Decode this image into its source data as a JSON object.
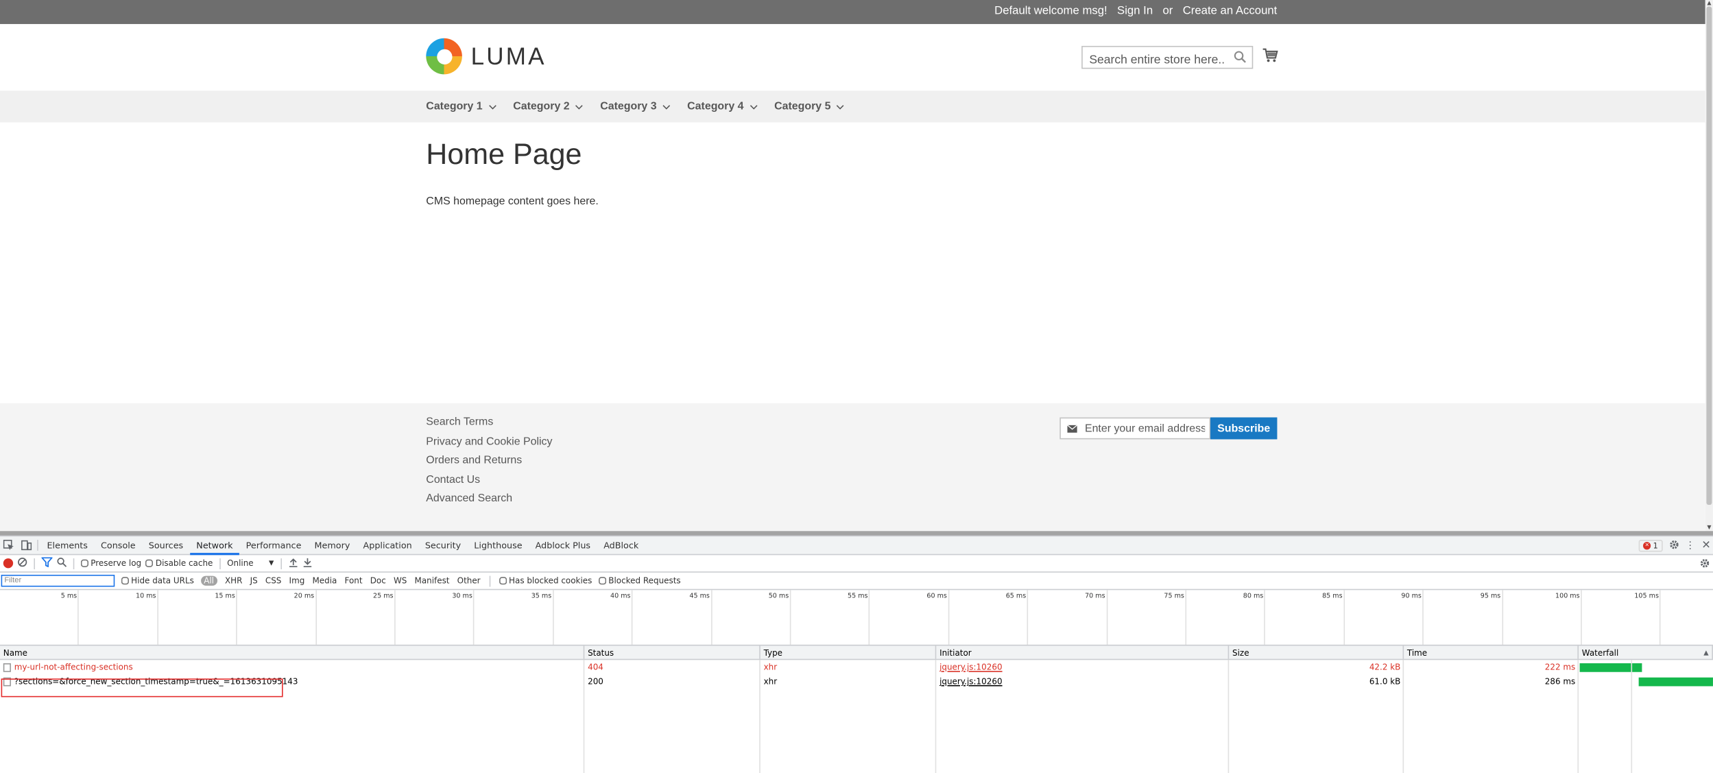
{
  "topbar": {
    "welcome": "Default welcome msg!",
    "sign_in": "Sign In",
    "or": "or",
    "create_account": "Create an Account"
  },
  "header": {
    "logo_text": "LUMA",
    "search_placeholder": "Search entire store here...",
    "cart_icon": "cart-icon"
  },
  "nav": {
    "items": [
      {
        "label": "Category 1"
      },
      {
        "label": "Category 2"
      },
      {
        "label": "Category 3"
      },
      {
        "label": "Category 4"
      },
      {
        "label": "Category 5"
      }
    ]
  },
  "main": {
    "title": "Home Page",
    "content": "CMS homepage content goes here."
  },
  "footer": {
    "links": [
      "Search Terms",
      "Privacy and Cookie Policy",
      "Orders and Returns",
      "Contact Us",
      "Advanced Search"
    ],
    "newsletter_placeholder": "Enter your email address",
    "subscribe_label": "Subscribe"
  },
  "devtools": {
    "tabs": [
      "Elements",
      "Console",
      "Sources",
      "Network",
      "Performance",
      "Memory",
      "Application",
      "Security",
      "Lighthouse",
      "Adblock Plus",
      "AdBlock"
    ],
    "active_tab": "Network",
    "error_count": "1",
    "toolbar": {
      "preserve_log": "Preserve log",
      "disable_cache": "Disable cache",
      "throttling": "Online"
    },
    "filter": {
      "placeholder": "Filter",
      "hide_data_urls": "Hide data URLs",
      "types": [
        "All",
        "XHR",
        "JS",
        "CSS",
        "Img",
        "Media",
        "Font",
        "Doc",
        "WS",
        "Manifest",
        "Other"
      ],
      "has_blocked_cookies": "Has blocked cookies",
      "blocked_requests": "Blocked Requests"
    },
    "timeline_ticks": [
      "5 ms",
      "10 ms",
      "15 ms",
      "20 ms",
      "25 ms",
      "30 ms",
      "35 ms",
      "40 ms",
      "45 ms",
      "50 ms",
      "55 ms",
      "60 ms",
      "65 ms",
      "70 ms",
      "75 ms",
      "80 ms",
      "85 ms",
      "90 ms",
      "95 ms",
      "100 ms",
      "105 ms"
    ],
    "columns": [
      "Name",
      "Status",
      "Type",
      "Initiator",
      "Size",
      "Time",
      "Waterfall"
    ],
    "requests": [
      {
        "name": "my-url-not-affecting-sections",
        "status": "404",
        "type": "xhr",
        "initiator": "jquery.js:10260",
        "size": "42.2 kB",
        "time": "222 ms"
      },
      {
        "name": "?sections=&force_new_section_timestamp=true&_=1613631095143",
        "status": "200",
        "type": "xhr",
        "initiator": "jquery.js:10260",
        "size": "61.0 kB",
        "time": "286 ms"
      }
    ],
    "colors": {
      "bar": "#14b84c",
      "error": "#d93025",
      "accent": "#1a73e8"
    }
  }
}
